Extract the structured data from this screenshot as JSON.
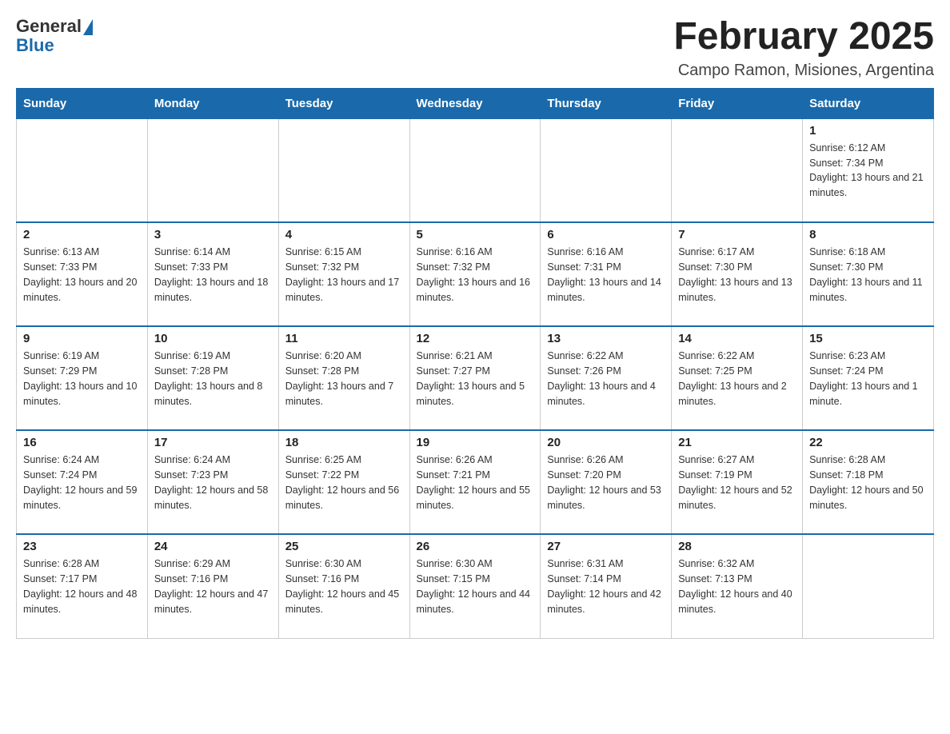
{
  "header": {
    "logo_general": "General",
    "logo_blue": "Blue",
    "main_title": "February 2025",
    "subtitle": "Campo Ramon, Misiones, Argentina"
  },
  "days_of_week": [
    "Sunday",
    "Monday",
    "Tuesday",
    "Wednesday",
    "Thursday",
    "Friday",
    "Saturday"
  ],
  "weeks": [
    [
      {
        "day": "",
        "sunrise": "",
        "sunset": "",
        "daylight": ""
      },
      {
        "day": "",
        "sunrise": "",
        "sunset": "",
        "daylight": ""
      },
      {
        "day": "",
        "sunrise": "",
        "sunset": "",
        "daylight": ""
      },
      {
        "day": "",
        "sunrise": "",
        "sunset": "",
        "daylight": ""
      },
      {
        "day": "",
        "sunrise": "",
        "sunset": "",
        "daylight": ""
      },
      {
        "day": "",
        "sunrise": "",
        "sunset": "",
        "daylight": ""
      },
      {
        "day": "1",
        "sunrise": "Sunrise: 6:12 AM",
        "sunset": "Sunset: 7:34 PM",
        "daylight": "Daylight: 13 hours and 21 minutes."
      }
    ],
    [
      {
        "day": "2",
        "sunrise": "Sunrise: 6:13 AM",
        "sunset": "Sunset: 7:33 PM",
        "daylight": "Daylight: 13 hours and 20 minutes."
      },
      {
        "day": "3",
        "sunrise": "Sunrise: 6:14 AM",
        "sunset": "Sunset: 7:33 PM",
        "daylight": "Daylight: 13 hours and 18 minutes."
      },
      {
        "day": "4",
        "sunrise": "Sunrise: 6:15 AM",
        "sunset": "Sunset: 7:32 PM",
        "daylight": "Daylight: 13 hours and 17 minutes."
      },
      {
        "day": "5",
        "sunrise": "Sunrise: 6:16 AM",
        "sunset": "Sunset: 7:32 PM",
        "daylight": "Daylight: 13 hours and 16 minutes."
      },
      {
        "day": "6",
        "sunrise": "Sunrise: 6:16 AM",
        "sunset": "Sunset: 7:31 PM",
        "daylight": "Daylight: 13 hours and 14 minutes."
      },
      {
        "day": "7",
        "sunrise": "Sunrise: 6:17 AM",
        "sunset": "Sunset: 7:30 PM",
        "daylight": "Daylight: 13 hours and 13 minutes."
      },
      {
        "day": "8",
        "sunrise": "Sunrise: 6:18 AM",
        "sunset": "Sunset: 7:30 PM",
        "daylight": "Daylight: 13 hours and 11 minutes."
      }
    ],
    [
      {
        "day": "9",
        "sunrise": "Sunrise: 6:19 AM",
        "sunset": "Sunset: 7:29 PM",
        "daylight": "Daylight: 13 hours and 10 minutes."
      },
      {
        "day": "10",
        "sunrise": "Sunrise: 6:19 AM",
        "sunset": "Sunset: 7:28 PM",
        "daylight": "Daylight: 13 hours and 8 minutes."
      },
      {
        "day": "11",
        "sunrise": "Sunrise: 6:20 AM",
        "sunset": "Sunset: 7:28 PM",
        "daylight": "Daylight: 13 hours and 7 minutes."
      },
      {
        "day": "12",
        "sunrise": "Sunrise: 6:21 AM",
        "sunset": "Sunset: 7:27 PM",
        "daylight": "Daylight: 13 hours and 5 minutes."
      },
      {
        "day": "13",
        "sunrise": "Sunrise: 6:22 AM",
        "sunset": "Sunset: 7:26 PM",
        "daylight": "Daylight: 13 hours and 4 minutes."
      },
      {
        "day": "14",
        "sunrise": "Sunrise: 6:22 AM",
        "sunset": "Sunset: 7:25 PM",
        "daylight": "Daylight: 13 hours and 2 minutes."
      },
      {
        "day": "15",
        "sunrise": "Sunrise: 6:23 AM",
        "sunset": "Sunset: 7:24 PM",
        "daylight": "Daylight: 13 hours and 1 minute."
      }
    ],
    [
      {
        "day": "16",
        "sunrise": "Sunrise: 6:24 AM",
        "sunset": "Sunset: 7:24 PM",
        "daylight": "Daylight: 12 hours and 59 minutes."
      },
      {
        "day": "17",
        "sunrise": "Sunrise: 6:24 AM",
        "sunset": "Sunset: 7:23 PM",
        "daylight": "Daylight: 12 hours and 58 minutes."
      },
      {
        "day": "18",
        "sunrise": "Sunrise: 6:25 AM",
        "sunset": "Sunset: 7:22 PM",
        "daylight": "Daylight: 12 hours and 56 minutes."
      },
      {
        "day": "19",
        "sunrise": "Sunrise: 6:26 AM",
        "sunset": "Sunset: 7:21 PM",
        "daylight": "Daylight: 12 hours and 55 minutes."
      },
      {
        "day": "20",
        "sunrise": "Sunrise: 6:26 AM",
        "sunset": "Sunset: 7:20 PM",
        "daylight": "Daylight: 12 hours and 53 minutes."
      },
      {
        "day": "21",
        "sunrise": "Sunrise: 6:27 AM",
        "sunset": "Sunset: 7:19 PM",
        "daylight": "Daylight: 12 hours and 52 minutes."
      },
      {
        "day": "22",
        "sunrise": "Sunrise: 6:28 AM",
        "sunset": "Sunset: 7:18 PM",
        "daylight": "Daylight: 12 hours and 50 minutes."
      }
    ],
    [
      {
        "day": "23",
        "sunrise": "Sunrise: 6:28 AM",
        "sunset": "Sunset: 7:17 PM",
        "daylight": "Daylight: 12 hours and 48 minutes."
      },
      {
        "day": "24",
        "sunrise": "Sunrise: 6:29 AM",
        "sunset": "Sunset: 7:16 PM",
        "daylight": "Daylight: 12 hours and 47 minutes."
      },
      {
        "day": "25",
        "sunrise": "Sunrise: 6:30 AM",
        "sunset": "Sunset: 7:16 PM",
        "daylight": "Daylight: 12 hours and 45 minutes."
      },
      {
        "day": "26",
        "sunrise": "Sunrise: 6:30 AM",
        "sunset": "Sunset: 7:15 PM",
        "daylight": "Daylight: 12 hours and 44 minutes."
      },
      {
        "day": "27",
        "sunrise": "Sunrise: 6:31 AM",
        "sunset": "Sunset: 7:14 PM",
        "daylight": "Daylight: 12 hours and 42 minutes."
      },
      {
        "day": "28",
        "sunrise": "Sunrise: 6:32 AM",
        "sunset": "Sunset: 7:13 PM",
        "daylight": "Daylight: 12 hours and 40 minutes."
      },
      {
        "day": "",
        "sunrise": "",
        "sunset": "",
        "daylight": ""
      }
    ]
  ]
}
